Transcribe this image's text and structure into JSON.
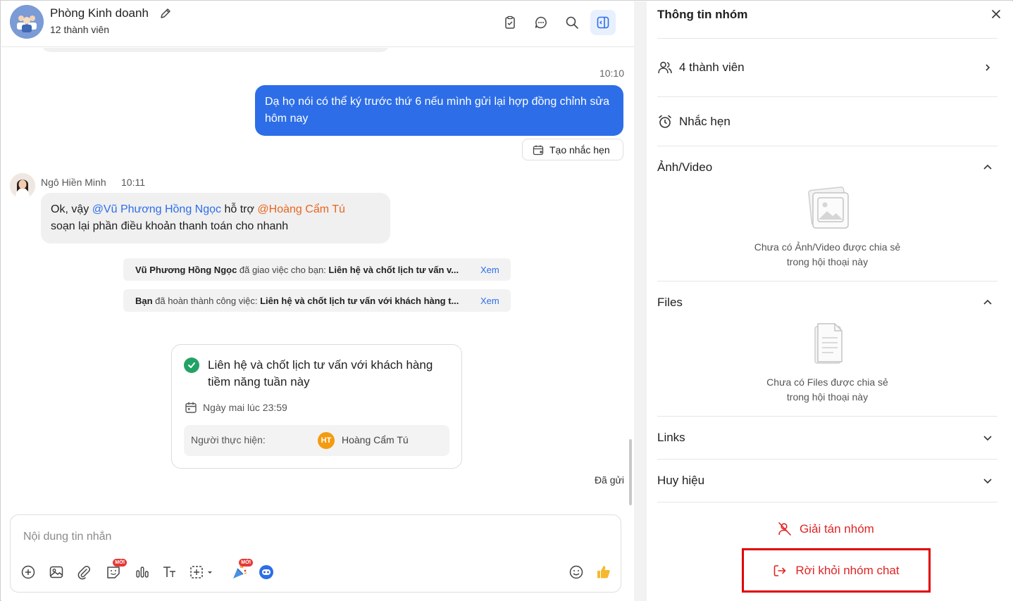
{
  "header": {
    "group_name": "Phòng Kinh doanh",
    "member_count": "12 thành viên",
    "icons": [
      "edit-icon",
      "task-clipboard-icon",
      "chat-thread-icon",
      "search-icon",
      "sidebar-toggle-icon"
    ]
  },
  "messages": {
    "my_time": "10:10",
    "my_message": "Dạ họ nói có thể ký trước thứ 6 nếu mình gửi lại hợp đồng chỉnh sửa hôm nay",
    "remind_label": "Tạo nhắc hẹn",
    "sender_name": "Ngô Hiền Minh",
    "sender_time": "10:11",
    "their_message": {
      "p1": "Ok, vậy ",
      "mention1": "@Vũ Phương Hồng Ngọc",
      "p2": " hỗ trợ ",
      "mention2": "@Hoàng Cẩm Tú",
      "p3": "soạn lại phần điều khoản thanh toán cho nhanh"
    },
    "system_notes": [
      {
        "actor": "Vũ Phương Hồng Ngọc",
        "action": " đã giao việc cho bạn: ",
        "task": "Liên hệ và chốt lịch tư vấn v...",
        "link": "Xem"
      },
      {
        "actor": "Bạn",
        "action": " đã hoàn thành công việc: ",
        "task": "Liên hệ và chốt lịch tư vấn với khách hàng t...",
        "link": "Xem"
      }
    ],
    "task_card": {
      "title": "Liên hệ và chốt lịch tư vấn với khách hàng tiềm năng tuần này",
      "due": "Ngày mai lúc 23:59",
      "assignee_label": "Người thực hiện:",
      "assignee_initials": "HT",
      "assignee_name": "Hoàng Cẩm Tú"
    },
    "sent_status": "Đã gửi"
  },
  "composer": {
    "placeholder": "Nội dung tin nhắn",
    "new_tag": "MỚI",
    "tools": [
      "add-icon",
      "image-icon",
      "attachment-icon",
      "sticker-icon",
      "poll-icon",
      "text-format-icon",
      "screenshot-icon",
      "celebrate-icon",
      "bot-icon",
      "emoji-icon",
      "thumbs-up-icon"
    ]
  },
  "panel": {
    "title": "Thông tin nhóm",
    "members": "4 thành viên",
    "reminders": "Nhắc hẹn",
    "media_title": "Ảnh/Video",
    "media_empty_1": "Chưa có Ảnh/Video được chia sẻ",
    "media_empty_2": "trong hội thoại này",
    "files_title": "Files",
    "files_empty_1": "Chưa có Files được chia sẻ",
    "files_empty_2": "trong hội thoại này",
    "links_title": "Links",
    "badges_title": "Huy hiệu",
    "disband": "Giải tán nhóm",
    "leave": "Rời khỏi nhóm chat"
  },
  "colors": {
    "accent": "#2d6ee8",
    "mention_orange": "#e8651f",
    "danger": "#e02424",
    "success": "#21a366",
    "highlight_box": "#e00000"
  }
}
